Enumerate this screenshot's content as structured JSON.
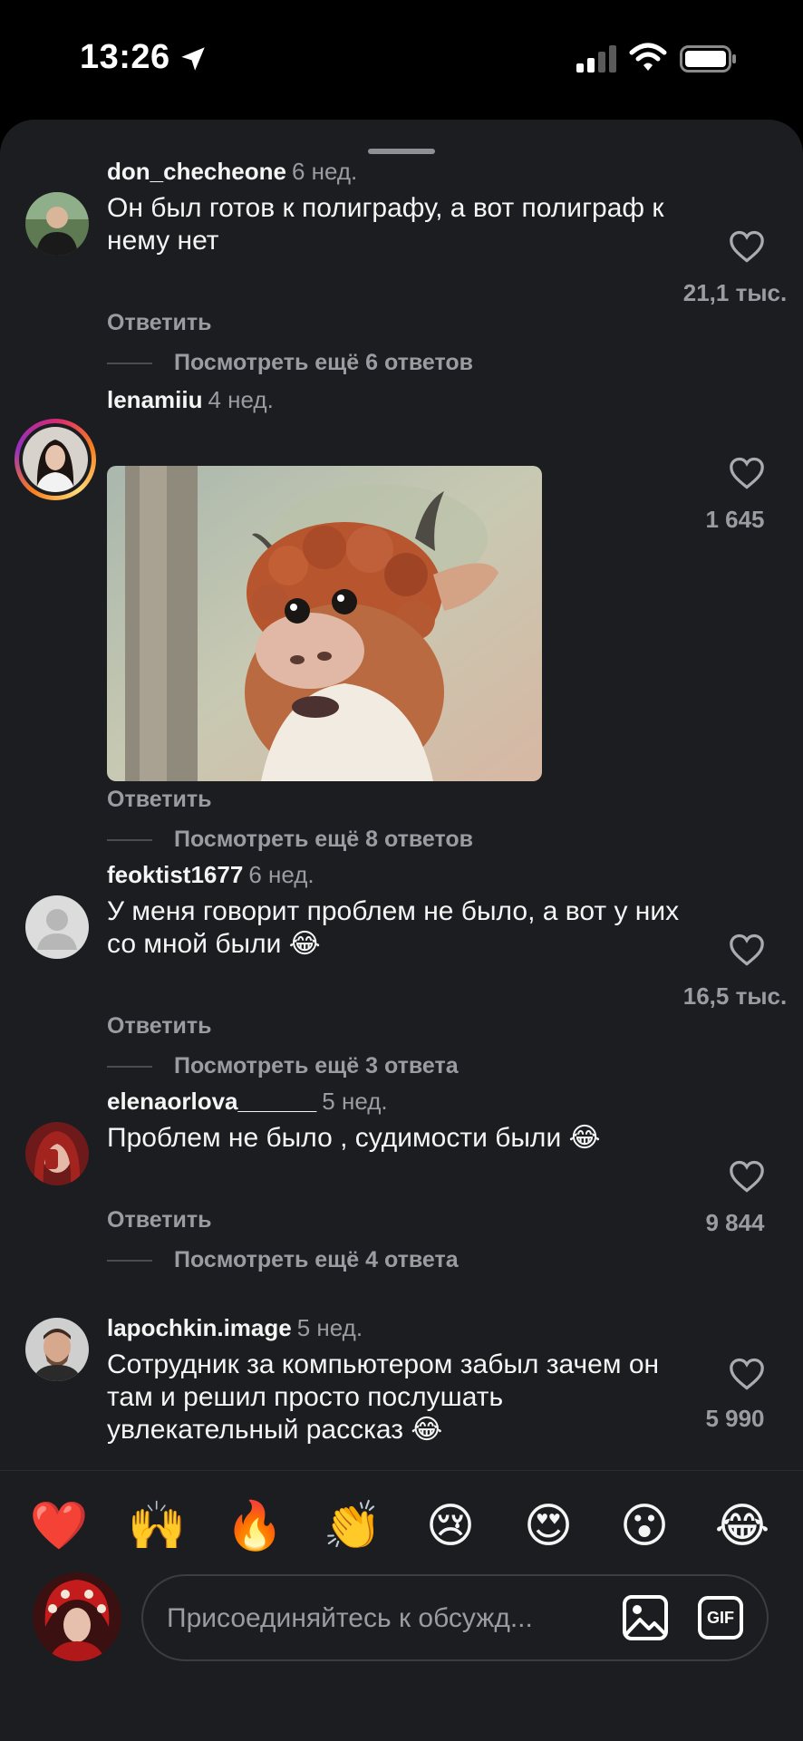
{
  "status_bar": {
    "time": "13:26"
  },
  "comments": [
    {
      "username": "don_checheone",
      "age": "6 нед.",
      "text": "Он был готов к полиграфу, а вот полиграф к нему нет",
      "likes": "21,1 тыс.",
      "reply_label": "Ответить",
      "more_replies": "Посмотреть ещё 6 ответов"
    },
    {
      "username": "lenamiiu",
      "age": "4 нед.",
      "attachment": "gif",
      "likes": "1 645",
      "reply_label": "Ответить",
      "more_replies": "Посмотреть ещё 8 ответов"
    },
    {
      "username": "feoktist1677",
      "age": "6 нед.",
      "text": "У меня говорит проблем не было, а вот у них со мной были 😂",
      "likes": "16,5 тыс.",
      "reply_label": "Ответить",
      "more_replies": "Посмотреть ещё 3 ответа"
    },
    {
      "username": "elenaorlova______",
      "age": "5 нед.",
      "text": "Проблем не было , судимости были 😂",
      "likes": "9 844",
      "reply_label": "Ответить",
      "more_replies": "Посмотреть ещё 4 ответа"
    },
    {
      "username": "lapochkin.image",
      "age": "5 нед.",
      "text": "Сотрудник за компьютером забыл зачем он там и решил просто послушать увлекательный рассказ 😂",
      "likes": "5 990"
    }
  ],
  "quick_reactions": [
    "❤️",
    "🙌",
    "🔥",
    "👏",
    "😢",
    "😍",
    "😮",
    "😂"
  ],
  "composer": {
    "placeholder": "Присоединяйтесь к обсужд...",
    "gif_label": "GIF"
  },
  "colors": {
    "sheet_bg": "#1b1d20",
    "secondary_text": "#9a9ca1",
    "primary_text": "#f5f5f5"
  }
}
